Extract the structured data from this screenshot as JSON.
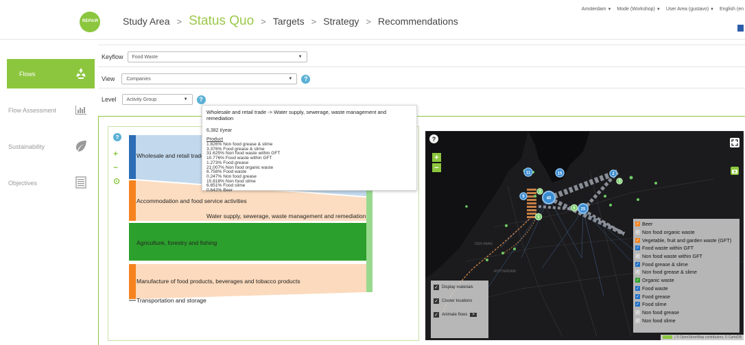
{
  "header": {
    "logo_text": "REPAiR",
    "crumbs": [
      "Study Area",
      "Status Quo",
      "Targets",
      "Strategy",
      "Recommendations"
    ],
    "active_crumb": 1,
    "separator": ">",
    "top_right": {
      "region": "Amsterdam",
      "mode": "Mode (Workshop)",
      "user": "User Area (gustavo)",
      "language": "English (en"
    }
  },
  "sidebar": {
    "items": [
      {
        "label": "Flows",
        "icon": "recycle-icon",
        "active": true
      },
      {
        "label": "Flow Assessment",
        "icon": "bar-chart-icon",
        "active": false
      },
      {
        "label": "Sustainability",
        "icon": "leaf-icon",
        "active": false
      },
      {
        "label": "Objectives",
        "icon": "list-icon",
        "active": false
      }
    ]
  },
  "filters": {
    "keyflow_label": "Keyflow",
    "keyflow_value": "Food Waste",
    "view_label": "View",
    "view_value": "Companies",
    "level_label": "Level",
    "level_value": "Activity Group",
    "help_glyph": "?"
  },
  "sankey": {
    "controls": {
      "help": "?",
      "zoom_in": "+",
      "zoom_out": "−",
      "reset": "⊙"
    },
    "nodes": [
      {
        "label": "Wholesale and retail trade",
        "color": "#4a90c8"
      },
      {
        "label": "Accommodation and food service activities",
        "color": "#f6831f"
      },
      {
        "label": "Agriculture, forestry and fishing",
        "color": "#2ca02c"
      },
      {
        "label": "Manufacture of food products, beverages and tobacco products",
        "color": "#f6831f"
      },
      {
        "label": "Transportation and storage",
        "color": "#999999"
      }
    ],
    "target_label": "Water supply, sewerage, waste management and remediation"
  },
  "tooltip": {
    "title": "Wholesale and retail trade -> Water supply, sewerage, waste management and remediation",
    "amount": "6,382 t/year",
    "product_heading": "Product",
    "lines": [
      "1.826% Non food grease & slime",
      "3.376% Food grease & slime",
      "31.625% Non food waste within GFT",
      "10.776% Food waste within GFT",
      "1.273% Food grease",
      "21.007% Non food organic waste",
      "6.758% Food waste",
      "0.247% Non food grease",
      "15.818% Non food slime",
      "6.651% Food slime",
      "0.642% Beer"
    ]
  },
  "map": {
    "help": "?",
    "zoom_in": "+",
    "zoom_out": "−",
    "cluster_labels": [
      "40",
      "25",
      "11",
      "15",
      "2",
      "6",
      "5",
      "9",
      "3",
      "3"
    ],
    "place_labels": [
      "DEN HAAG",
      "ROTTERDAM"
    ],
    "options": [
      {
        "label": "Display materials",
        "checked": true
      },
      {
        "label": "Cluster locations",
        "checked": true
      },
      {
        "label": "Animate flows",
        "checked": true,
        "button": ">"
      }
    ],
    "legend": [
      {
        "label": "Beer",
        "color": "#f6831f"
      },
      {
        "label": "Non food organic waste",
        "color": "#cccccc"
      },
      {
        "label": "Vegetable, fruit and garden waste (GFT)",
        "color": "#f6831f"
      },
      {
        "label": "Food waste within GFT",
        "color": "#1f6fc5"
      },
      {
        "label": "Non food waste within GFT",
        "color": "#cccccc"
      },
      {
        "label": "Food grease & slime",
        "color": "#1f6fc5"
      },
      {
        "label": "Non food grease & slime",
        "color": "#cccccc"
      },
      {
        "label": "Organic waste",
        "color": "#2ca02c"
      },
      {
        "label": "Food waste",
        "color": "#1f6fc5"
      },
      {
        "label": "Food grease",
        "color": "#1f6fc5"
      },
      {
        "label": "Food slime",
        "color": "#1f6fc5"
      },
      {
        "label": "Non food grease",
        "color": "#cccccc"
      },
      {
        "label": "Non food slime",
        "color": "#cccccc"
      }
    ],
    "attribution": "| © OpenStreetMap contributors, © CartoDB"
  }
}
